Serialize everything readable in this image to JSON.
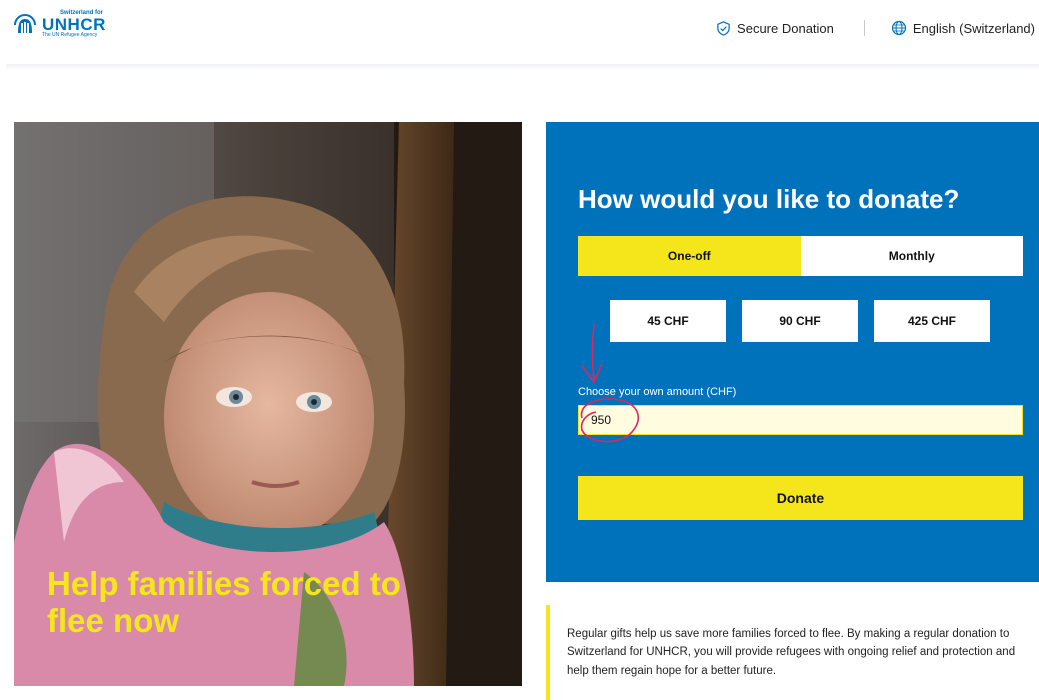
{
  "header": {
    "logo": {
      "top_text": "Switzerland for",
      "main_text": "UNHCR",
      "sub_text": "The UN Refugee Agency"
    },
    "secure_label": "Secure Donation",
    "language_label": "English (Switzerland)",
    "icons": {
      "secure": "shield-check-icon",
      "language": "globe-icon"
    }
  },
  "hero": {
    "title_line1": "Help families forced to",
    "title_line2": "flee now"
  },
  "donation": {
    "title": "How would you like to donate?",
    "frequency": [
      {
        "label": "One-off",
        "selected": true
      },
      {
        "label": "Monthly",
        "selected": false
      }
    ],
    "amounts": [
      "45 CHF",
      "90 CHF",
      "425 CHF"
    ],
    "own_amount_label": "Choose your own amount (CHF)",
    "own_amount_value": "950",
    "donate_label": "Donate"
  },
  "info_text": "Regular gifts help us save more families forced to flee. By making a regular donation to Switzerland for UNHCR, you will provide refugees with ongoing relief and protection and help them regain hope for a better future.",
  "colors": {
    "brand_blue": "#0072bc",
    "accent_yellow": "#f5e61c",
    "annotation_pink": "#e0245e"
  }
}
